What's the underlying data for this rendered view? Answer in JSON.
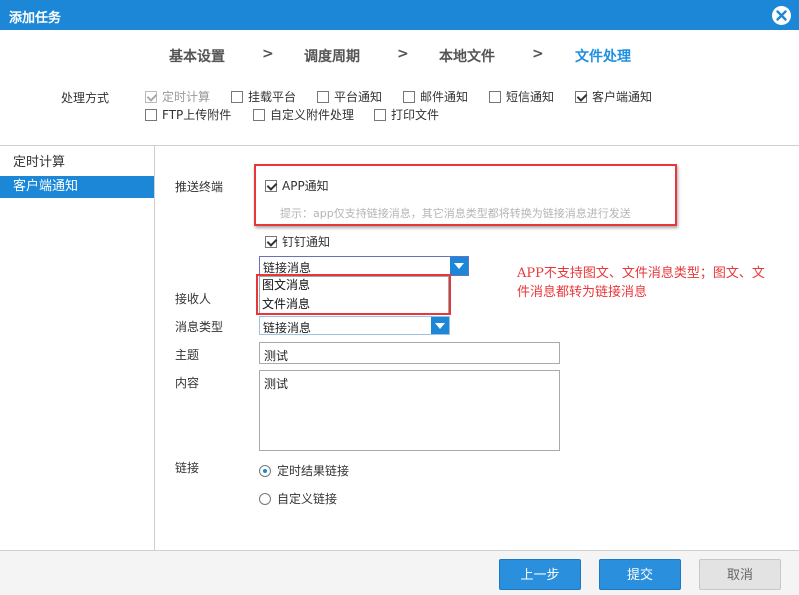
{
  "window": {
    "title": "添加任务"
  },
  "steps": [
    {
      "label": "基本设置"
    },
    {
      "label": "调度周期"
    },
    {
      "label": "本地文件"
    },
    {
      "label": "文件处理"
    }
  ],
  "step_separator": ">",
  "processing": {
    "label": "处理方式",
    "options": [
      {
        "label": "定时计算",
        "checked": true,
        "disabled": true
      },
      {
        "label": "挂载平台",
        "checked": false
      },
      {
        "label": "平台通知",
        "checked": false
      },
      {
        "label": "邮件通知",
        "checked": false
      },
      {
        "label": "短信通知",
        "checked": false
      },
      {
        "label": "客户端通知",
        "checked": true
      },
      {
        "label": "FTP上传附件",
        "checked": false
      },
      {
        "label": "自定义附件处理",
        "checked": false
      },
      {
        "label": "打印文件",
        "checked": false
      }
    ]
  },
  "sidebar": {
    "items": [
      {
        "label": "定时计算",
        "active": false
      },
      {
        "label": "客户端通知",
        "active": true
      }
    ]
  },
  "form": {
    "push_label": "推送终端",
    "app_notify": {
      "label": "APP通知",
      "checked": true
    },
    "hint": "提示：app仅支持链接消息，其它消息类型都将转换为链接消息进行发送",
    "dingtalk_notify": {
      "label": "钉钉通知",
      "checked": true
    },
    "dropdown_value": "链接消息",
    "dropdown_options": [
      "图文消息",
      "文件消息"
    ],
    "recipient_label": "接收人",
    "msg_type_label": "消息类型",
    "msg_type_value": "链接消息",
    "subject_label": "主题",
    "subject_value": "测试",
    "content_label": "内容",
    "content_value": "测试",
    "link_label": "链接",
    "link_options": [
      {
        "label": "定时结果链接",
        "selected": true
      },
      {
        "label": "自定义链接",
        "selected": false
      }
    ]
  },
  "annotation": "APP不支持图文、文件消息类型；图文、文件消息都转为链接消息",
  "buttons": {
    "prev": "上一步",
    "submit": "提交",
    "cancel": "取消"
  },
  "colors": {
    "accent": "#1b87d6",
    "highlight": "#e8373a"
  }
}
